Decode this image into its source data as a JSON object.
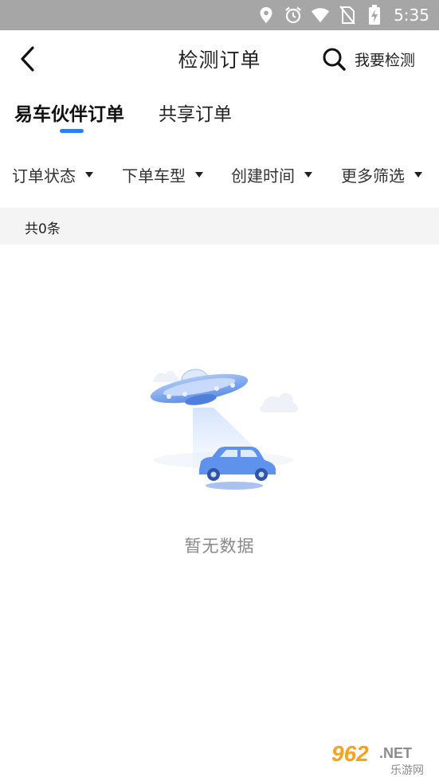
{
  "status_bar": {
    "time": "5:35",
    "icons": [
      "location-icon",
      "alarm-icon",
      "wifi-icon",
      "no-sim-icon",
      "battery-charging-icon"
    ]
  },
  "header": {
    "title": "检测订单",
    "search_label": "我要检测"
  },
  "tabs": [
    {
      "label": "易车伙伴订单",
      "active": true
    },
    {
      "label": "共享订单",
      "active": false
    }
  ],
  "filters": [
    {
      "label": "订单状态"
    },
    {
      "label": "下单车型"
    },
    {
      "label": "创建时间"
    },
    {
      "label": "更多筛选"
    }
  ],
  "count_text": "共0条",
  "empty_state": {
    "text": "暂无数据",
    "illustration": "ufo-abducting-car"
  },
  "watermark": {
    "brand": "962",
    "suffix": ".NET",
    "subtitle": "乐游网"
  },
  "colors": {
    "status_bar_bg": "#a6a6a6",
    "accent": "#2d7ef6",
    "count_bar_bg": "#f4f4f4",
    "empty_text": "#8a8a8a",
    "watermark_orange": "#f7a21b"
  }
}
